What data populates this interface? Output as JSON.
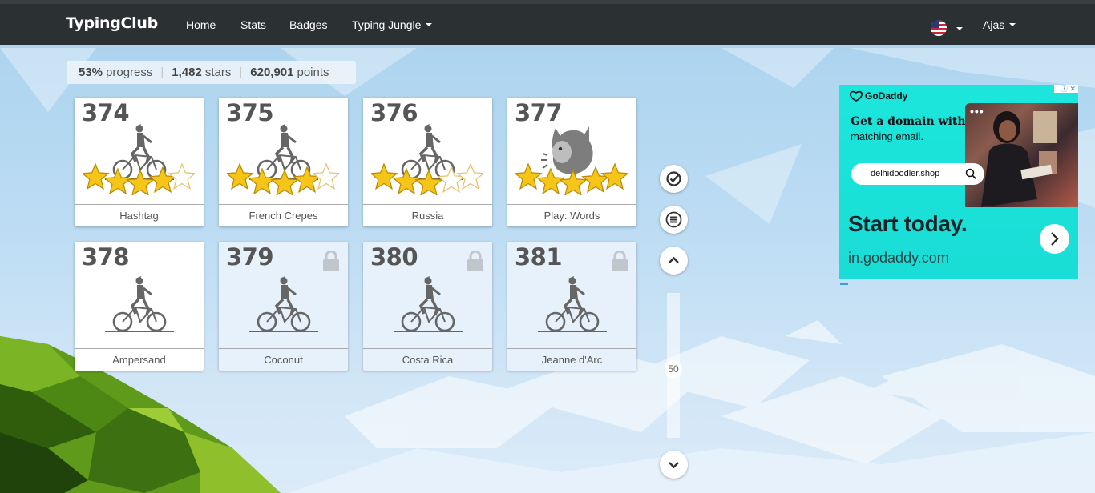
{
  "nav": {
    "brand": "TypingClub",
    "items": [
      {
        "label": "Home"
      },
      {
        "label": "Stats"
      },
      {
        "label": "Badges"
      },
      {
        "label": "Typing Jungle"
      }
    ],
    "user": "Ajas",
    "language_flag": "us-flag-icon"
  },
  "progress": {
    "percent_value": "53%",
    "percent_label": "progress",
    "stars_value": "1,482",
    "stars_label": "stars",
    "points_value": "620,901",
    "points_label": "points"
  },
  "lessons": [
    {
      "number": "374",
      "name": "Hashtag",
      "stars": 4,
      "locked": false,
      "icon": "cyclist-icon"
    },
    {
      "number": "375",
      "name": "French Crepes",
      "stars": 4,
      "locked": false,
      "icon": "cyclist-icon"
    },
    {
      "number": "376",
      "name": "Russia",
      "stars": 3,
      "locked": false,
      "icon": "cyclist-icon"
    },
    {
      "number": "377",
      "name": "Play: Words",
      "stars": 5,
      "locked": false,
      "icon": "monster-icon"
    },
    {
      "number": "378",
      "name": "Ampersand",
      "stars": 0,
      "locked": false,
      "icon": "cyclist-icon"
    },
    {
      "number": "379",
      "name": "Coconut",
      "stars": 0,
      "locked": true,
      "icon": "cyclist-icon"
    },
    {
      "number": "380",
      "name": "Costa Rica",
      "stars": 0,
      "locked": true,
      "icon": "cyclist-icon"
    },
    {
      "number": "381",
      "name": "Jeanne d'Arc",
      "stars": 0,
      "locked": true,
      "icon": "cyclist-icon"
    }
  ],
  "sidebar_controls": {
    "icons": [
      "check-circle-icon",
      "menu-icon",
      "chevron-up-icon",
      "chevron-down-icon"
    ],
    "scroll_label": "50"
  },
  "ad": {
    "brand": "GoDaddy",
    "headline": "Get a domain with",
    "subline": "matching email.",
    "search_text": "delhidoodler.shop",
    "cta": "Start today.",
    "url": "in.godaddy.com"
  },
  "colors": {
    "navbar": "#2b3033",
    "star": "#f5c518",
    "ad_background": "#1ce6dc",
    "sky": "#bcdcf3"
  }
}
